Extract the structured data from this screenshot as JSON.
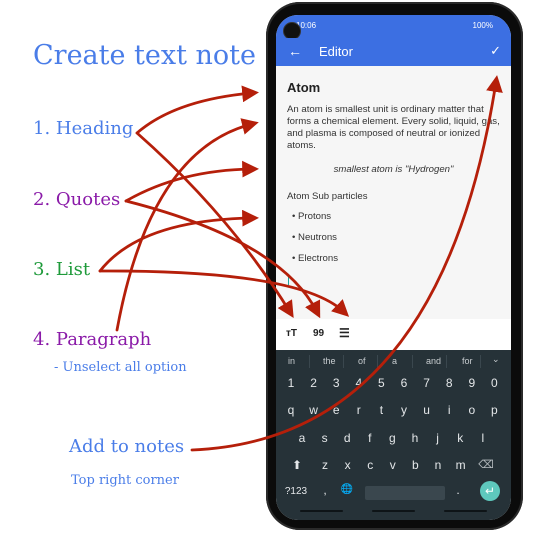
{
  "annotations": {
    "title": "Create text note",
    "heading": "1. Heading",
    "quotes": "2. Quotes",
    "list": "3. List",
    "paragraph": "4. Paragraph",
    "paragraph_note": "- Unselect all option",
    "add_to_notes": "Add to notes",
    "add_to_notes_note": "Top right corner"
  },
  "colors": {
    "accent_blue": "#3c6fe2",
    "annotation_blue": "#4a7de8",
    "annotation_purple": "#8a1aa8",
    "annotation_green": "#1e9a3a",
    "arrow_red": "#b51f0a",
    "keyboard_bg": "#263238",
    "enter_key": "#5ec8bd"
  },
  "status_bar": {
    "time": "10:06",
    "left_icons": [
      "notification-icon",
      "gallery-icon",
      "wifi-icon"
    ],
    "right_icons": [
      "lock-icon",
      "hotspot-icon",
      "volte-icon",
      "signal-icon"
    ],
    "battery": "100%"
  },
  "app_bar": {
    "back_icon": "←",
    "title": "Editor",
    "save_icon": "✓"
  },
  "note": {
    "heading": "Atom",
    "paragraph": "An atom is smallest unit is ordinary matter that forms a chemical element. Every solid, liquid, gas, and plasma is composed of neutral or ionized atoms.",
    "quote": "smallest atom is \"Hydrogen\"",
    "list_heading": "Atom Sub particles",
    "list_items": [
      "• Protons",
      "• Neutrons",
      "• Electrons"
    ]
  },
  "format_toolbar": {
    "heading_icon": "ᴛT",
    "quote_icon": "99",
    "list_icon": "☰"
  },
  "keyboard": {
    "suggestions": [
      "in",
      "the",
      "of",
      "a",
      "and",
      "for"
    ],
    "suggestion_expand": "⌄",
    "row_numbers": [
      "1",
      "2",
      "3",
      "4",
      "5",
      "6",
      "7",
      "8",
      "9",
      "0"
    ],
    "row1": [
      "q",
      "w",
      "e",
      "r",
      "t",
      "y",
      "u",
      "i",
      "o",
      "p"
    ],
    "row2": [
      "a",
      "s",
      "d",
      "f",
      "g",
      "h",
      "j",
      "k",
      "l"
    ],
    "row3": [
      "z",
      "x",
      "c",
      "v",
      "b",
      "n",
      "m"
    ],
    "shift": "⬆",
    "backspace": "⌫",
    "symbols": "?123",
    "comma": ",",
    "globe": "🌐",
    "period": ".",
    "enter": "↵"
  }
}
